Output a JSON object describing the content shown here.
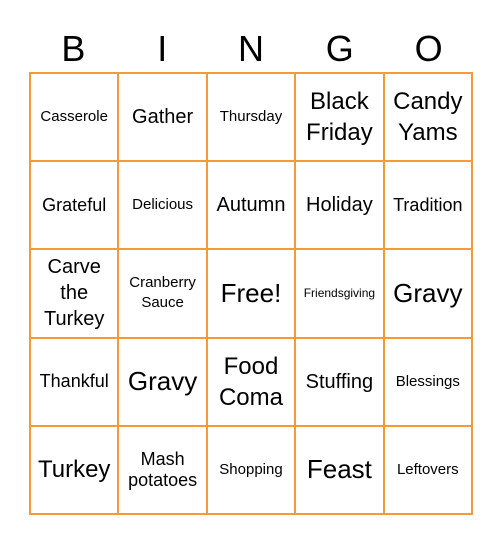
{
  "header": {
    "letters": [
      "B",
      "I",
      "N",
      "G",
      "O"
    ]
  },
  "theme": {
    "grid_color": "#f39b38",
    "text_color": "#000000"
  },
  "card": {
    "rows": [
      [
        "Casserole",
        "Gather",
        "Thursday",
        "Black Friday",
        "Candy Yams"
      ],
      [
        "Grateful",
        "Delicious",
        "Autumn",
        "Holiday",
        "Tradition"
      ],
      [
        "Carve the Turkey",
        "Cranberry Sauce",
        "Free!",
        "Friendsgiving",
        "Gravy"
      ],
      [
        "Thankful",
        "Gravy",
        "Food Coma",
        "Stuffing",
        "Blessings"
      ],
      [
        "Turkey",
        "Mash potatoes",
        "Shopping",
        "Feast",
        "Leftovers"
      ]
    ]
  }
}
